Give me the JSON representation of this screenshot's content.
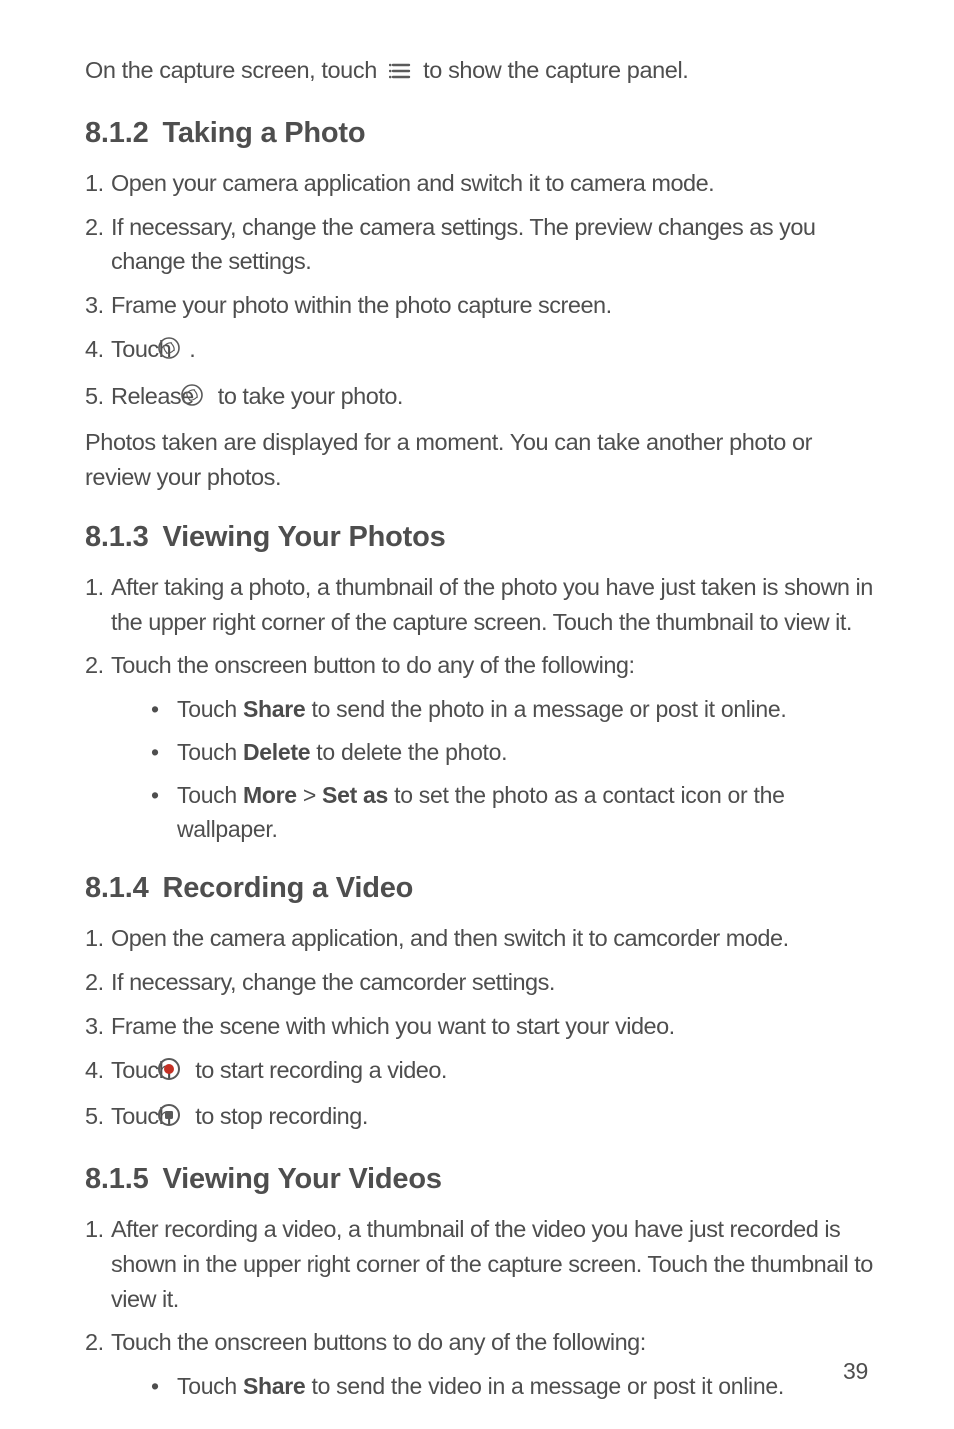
{
  "intro": {
    "before": "On the capture screen, touch",
    "after": "to show the capture panel."
  },
  "s812": {
    "num": "8.1.2",
    "title": "Taking a Photo",
    "items": [
      "Open your camera application and switch it to camera mode.",
      "If necessary, change the camera settings. The preview changes as you change the settings.",
      "Frame your photo within the photo capture screen."
    ],
    "item4_before": "Touch",
    "item4_after": ".",
    "item5_before": "Release",
    "item5_after": "to take your photo.",
    "note": "Photos taken are displayed for a moment. You can take another photo or review your photos."
  },
  "s813": {
    "num": "8.1.3",
    "title": "Viewing Your Photos",
    "item1": "After taking a photo, a thumbnail of the photo you have just taken is shown in the upper right corner of the capture screen. Touch the thumbnail to view it.",
    "item2": "Touch the onscreen button to do any of the following:",
    "bullets": {
      "b1_pre": "Touch ",
      "b1_bold": "Share",
      "b1_post": " to send the photo in a message or post it online.",
      "b2_pre": "Touch ",
      "b2_bold": "Delete",
      "b2_post": " to delete the photo.",
      "b3_pre": "Touch ",
      "b3_bold1": "More",
      "b3_mid": " > ",
      "b3_bold2": "Set as",
      "b3_post": " to set the photo as a contact icon or the wallpaper."
    }
  },
  "s814": {
    "num": "8.1.4",
    "title": "Recording a Video",
    "items": [
      "Open the camera application, and then switch it to camcorder mode.",
      "If necessary, change the camcorder settings.",
      "Frame the scene with which you want to start your video."
    ],
    "item4_before": "Touch",
    "item4_after": "to start recording a video.",
    "item5_before": "Touch",
    "item5_after": "to stop recording."
  },
  "s815": {
    "num": "8.1.5",
    "title": "Viewing Your Videos",
    "item1": "After recording a video, a thumbnail of the video you have just recorded is shown in the upper right corner of the capture screen. Touch the thumbnail to view it.",
    "item2": "Touch the onscreen buttons to do any of the following:",
    "bullets": {
      "b1_pre": "Touch ",
      "b1_bold": "Share",
      "b1_post": " to send the video in a message or post it online."
    }
  },
  "page_number": "39",
  "icons": {
    "menu": "menu-icon",
    "shutter": "shutter-icon",
    "record": "record-icon",
    "stop": "stop-icon"
  }
}
